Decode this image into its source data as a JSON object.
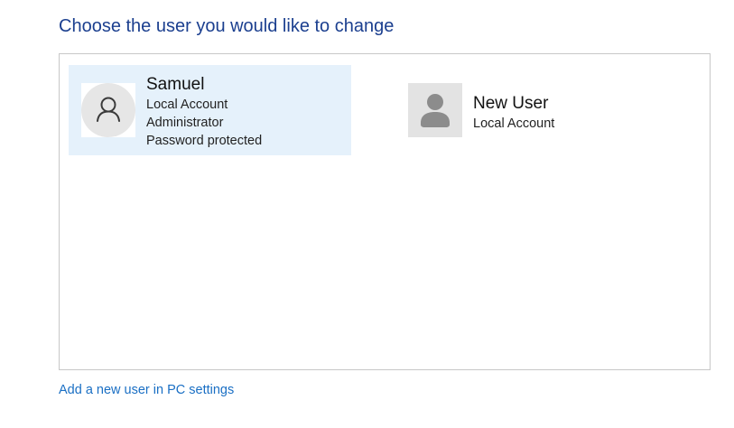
{
  "page": {
    "title": "Choose the user you would like to change"
  },
  "users": [
    {
      "name": "Samuel",
      "details": [
        "Local Account",
        "Administrator",
        "Password protected"
      ],
      "selected": true,
      "avatar_icon": "user-outline-icon"
    },
    {
      "name": "New User",
      "details": [
        "Local Account"
      ],
      "selected": false,
      "avatar_icon": "user-silhouette-icon"
    }
  ],
  "footer": {
    "add_user_link": "Add a new user in PC settings"
  },
  "colors": {
    "title": "#1b3f8f",
    "link": "#1a6fc4",
    "selected_tile": "#e5f1fb",
    "panel_border": "#c8c8c8"
  }
}
